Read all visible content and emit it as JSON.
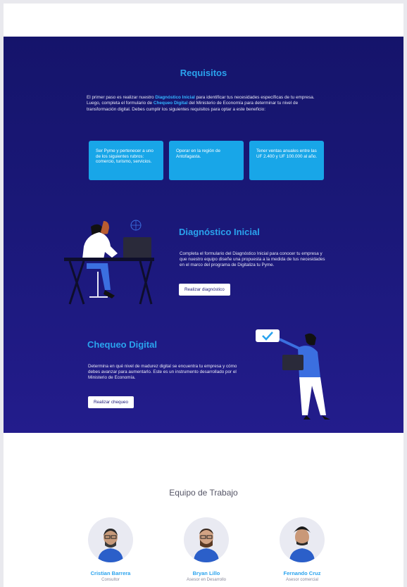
{
  "requisitos": {
    "title": "Requisitos",
    "intro_pre": "El primer paso es realizar nuestro ",
    "intro_link1": "Diagnóstico Inicial",
    "intro_mid": " para identificar tus necesidades específicas de tu empresa. Luego, completa el formulario de ",
    "intro_link2": "Chequeo Digital",
    "intro_post": " del Ministerio de Economía para determinar tu nivel de transformación digital. Debes cumplir los siguientes requisitos para optar a este beneficio:",
    "cards": [
      "Ser Pyme y pertenecer a uno de los siguientes rubros: comercio, turismo, servicios.",
      "Operar en la región de Antofagasta.",
      "Tener ventas anuales entre las UF 2.400 y UF 100.000 al año."
    ]
  },
  "diagnostico": {
    "title": "Diagnóstico Inicial",
    "text": "Completa el formulario del Diagnóstico Inicial para conocer tu empresa y que nuestro equipo diseñe una propuesta a la medida de tus necesidades en el marco del programa de Digitaliza tu Pyme.",
    "button": "Realizar diagnóstico"
  },
  "chequeo": {
    "title": "Chequeo Digital",
    "text": "Determina en qué nivel de madurez digital se encuentra tu empresa y cómo debes avanzar para aumentarlo. Este es un instrumento desarrollado por el Ministerio de Economía.",
    "button": "Realizar chequeo"
  },
  "team": {
    "title": "Equipo de Trabajo",
    "members": [
      {
        "name": "Cristian Barrera",
        "role": "Consultor"
      },
      {
        "name": "Bryan Lillo",
        "role": "Asesor en Desarrollo"
      },
      {
        "name": "Fernando Cruz",
        "role": "Asesor comercial"
      }
    ]
  },
  "colors": {
    "background": "#1a1878",
    "accent": "#2aa3ee",
    "card": "#18a6e8"
  }
}
